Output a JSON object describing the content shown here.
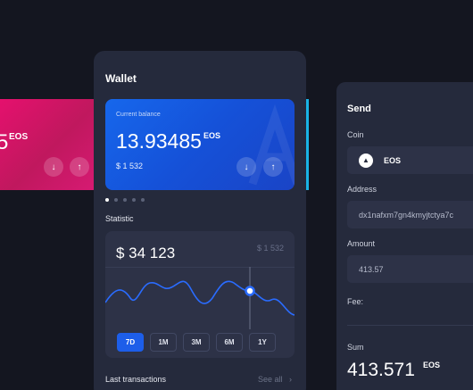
{
  "left_card": {
    "amount": "5",
    "currency": "EOS",
    "down_icon": "↓",
    "up_icon": "↑"
  },
  "wallet": {
    "title": "Wallet",
    "card": {
      "label": "Current balance",
      "amount": "13.93485",
      "currency": "EOS",
      "fiat": "$ 1 532",
      "down_icon": "↓",
      "up_icon": "↑"
    },
    "pager": {
      "count": 5,
      "active": 0
    },
    "statistic": {
      "label": "Statistic",
      "value": "$ 34 123",
      "compare": "$ 1 532",
      "ranges": [
        "7D",
        "1M",
        "3M",
        "6M",
        "1Y"
      ],
      "active_range": "7D"
    },
    "last_transactions": {
      "label": "Last transactions",
      "see_all": "See all",
      "chevron": "›"
    }
  },
  "send": {
    "title": "Send",
    "coin_label": "Coin",
    "coin_symbol": "▲",
    "coin_value": "EOS",
    "address_label": "Address",
    "address_value": "dx1nafxm7gn4kmyjtctya7c",
    "amount_label": "Amount",
    "amount_value": "413.57",
    "fee_label": "Fee:",
    "sum_label": "Sum",
    "sum_value": "413.571",
    "sum_currency": "EOS"
  },
  "colors": {
    "accent_blue": "#1d5ee9",
    "card_pink": "#e8106f",
    "card_teal": "#19b3e6",
    "panel": "#252a3c",
    "background": "#141620"
  }
}
